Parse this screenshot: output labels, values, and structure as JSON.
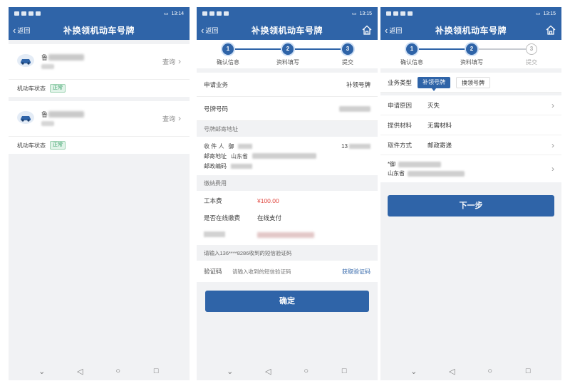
{
  "common": {
    "back_label": "返回",
    "nav_title": "补换领机动车号牌",
    "time_a": "13:14",
    "time_b": "13:15"
  },
  "steps": [
    "确认信息",
    "资料填写",
    "提交"
  ],
  "phone1": {
    "vehicles": [
      {
        "plate": "鲁",
        "query_label": "查询",
        "status_label": "机动车状态",
        "status_badge": "正常"
      },
      {
        "plate": "鲁",
        "query_label": "查询",
        "status_label": "机动车状态",
        "status_badge": "正常"
      }
    ]
  },
  "phone2": {
    "business_label": "申请业务",
    "business_value": "补领号牌",
    "plate_label": "号牌号码",
    "mail_section": "号牌邮寄地址",
    "recipient_label": "收 件 人",
    "recipient_value": "御",
    "recipient_phone": "13",
    "address_label": "邮寄地址",
    "address_value": "山东省",
    "postcode_label": "邮政编码",
    "fee_section": "缴纳费用",
    "fee_label": "工本费",
    "fee_value": "¥100.00",
    "online_label": "是否在线缴费",
    "online_value": "在线支付",
    "sms_note": "请输入136****8286收到的短信验证码",
    "code_label": "验证码",
    "code_placeholder": "请输入收到的短信验证码",
    "get_code": "获取验证码",
    "confirm_button": "确定"
  },
  "phone3": {
    "biz_type_label": "业务类型",
    "chip_active": "补领号牌",
    "chip_other": "换领号牌",
    "reason_label": "申请原因",
    "reason_value": "灭失",
    "materials_label": "提供材料",
    "materials_value": "无需材料",
    "pickup_label": "取件方式",
    "pickup_value": "邮政寄递",
    "addr_prefix": "*御",
    "addr_line2": "山东省",
    "next_button": "下一步"
  },
  "colors": {
    "primary": "#2f64a8",
    "fee_red": "#e0433b",
    "status_green": "#3aa06a"
  }
}
